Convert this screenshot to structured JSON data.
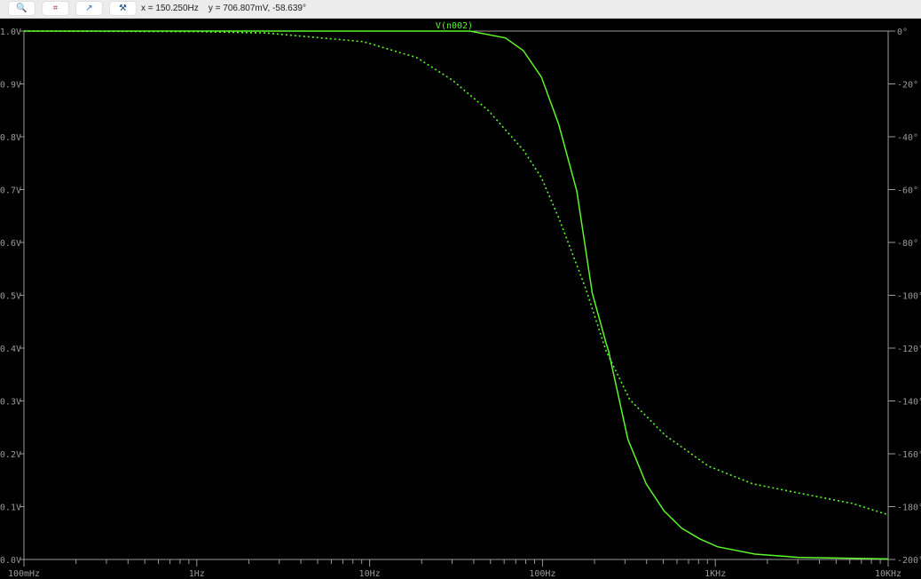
{
  "toolbar": {
    "buttons": [
      {
        "icon": "zoom-cancel-icon",
        "glyph": "🔍"
      },
      {
        "icon": "autorange-icon",
        "glyph": "⌗"
      },
      {
        "icon": "pan-icon",
        "glyph": "↗"
      },
      {
        "icon": "hammer-icon",
        "glyph": "⚒"
      }
    ],
    "cursor_x": "x = 150.250Hz",
    "cursor_y": "y = 706.807mV, -58.639°"
  },
  "chart_data": {
    "type": "line",
    "title": "V(n002)",
    "xscale": "log",
    "xlim": [
      0.1,
      10000
    ],
    "xticks": [
      {
        "v": 0.1,
        "label": "100mHz"
      },
      {
        "v": 1,
        "label": "1Hz"
      },
      {
        "v": 10,
        "label": "10Hz"
      },
      {
        "v": 100,
        "label": "100Hz"
      },
      {
        "v": 1000,
        "label": "1KHz"
      },
      {
        "v": 10000,
        "label": "10KHz"
      }
    ],
    "ylim": [
      0,
      1.0
    ],
    "yticks": [
      "0.0V",
      "0.1V",
      "0.2V",
      "0.3V",
      "0.4V",
      "0.5V",
      "0.6V",
      "0.7V",
      "0.8V",
      "0.9V",
      "1.0V"
    ],
    "y2lim": [
      -200,
      0
    ],
    "y2ticks": [
      "0°",
      "-20°",
      "-40°",
      "-60°",
      "-80°",
      "-100°",
      "-120°",
      "-140°",
      "-160°",
      "-180°",
      "-200°"
    ],
    "grid": false,
    "colors": {
      "trace": "#5df52c",
      "axis": "#9a9a9a",
      "background": "#000000"
    },
    "series": [
      {
        "kind": "magnitude",
        "style": "solid",
        "x": [
          0.1,
          10,
          38,
          61,
          77.5,
          98.6,
          124,
          158,
          194,
          233,
          241,
          312,
          398,
          505,
          640,
          812,
          1030,
          1700,
          3000,
          10000
        ],
        "y": [
          1.0,
          1.0,
          1.0,
          0.987,
          0.963,
          0.913,
          0.824,
          0.697,
          0.504,
          0.41,
          0.395,
          0.227,
          0.143,
          0.092,
          0.059,
          0.039,
          0.024,
          0.01,
          0.004,
          0.001
        ]
      },
      {
        "kind": "phase",
        "style": "dotted",
        "x": [
          0.1,
          1,
          2.5,
          9.2,
          18.7,
          30,
          48.5,
          77.5,
          98.6,
          124,
          178,
          233,
          320,
          513,
          915,
          1650,
          3000,
          6200,
          9900
        ],
        "y": [
          0,
          -0.2,
          -0.7,
          -4,
          -10,
          -18.5,
          -30,
          -45,
          -55.5,
          -70.6,
          -97.5,
          -121,
          -139.5,
          -153,
          -164.7,
          -171.4,
          -174.8,
          -178.8,
          -183
        ]
      }
    ]
  }
}
